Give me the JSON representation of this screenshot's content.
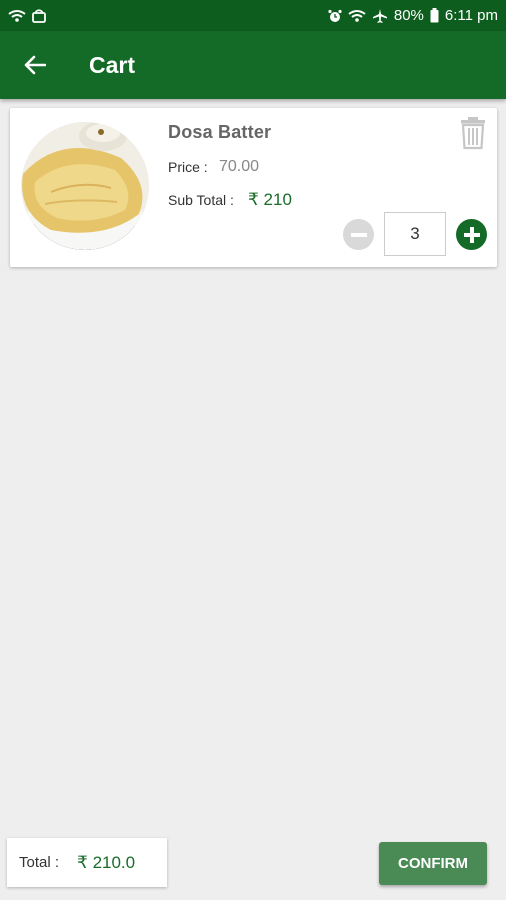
{
  "status_bar": {
    "battery": "80%",
    "time": "6:11 pm"
  },
  "app_bar": {
    "title": "Cart"
  },
  "cart_item": {
    "name": "Dosa Batter",
    "price_label": "Price :",
    "price_value": "70.00",
    "subtotal_label": "Sub Total :",
    "subtotal_value": "₹ 210",
    "quantity": "3"
  },
  "footer": {
    "total_label": "Total :",
    "total_value": "₹  210.0",
    "confirm_label": "CONFIRM"
  },
  "colors": {
    "status_bar": "#0d5e1e",
    "app_bar": "#146b28",
    "accent_text": "#1b6b2a",
    "confirm_button": "#4a8a55",
    "background": "#eeeeee"
  }
}
